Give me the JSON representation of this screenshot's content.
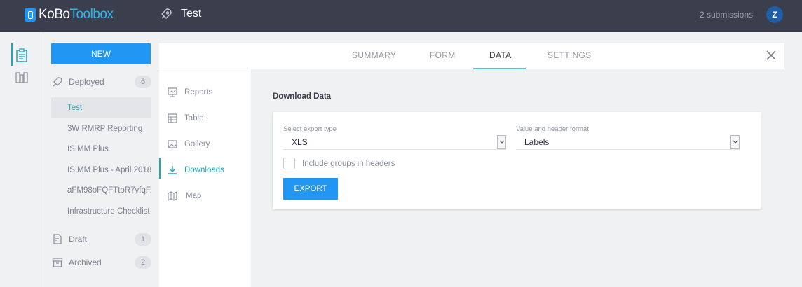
{
  "header": {
    "logo_main": "KoBo",
    "logo_thin": "Toolbox",
    "form_title": "Test",
    "submissions": "2 submissions",
    "avatar_initial": "Z"
  },
  "sidebar": {
    "new_label": "NEW",
    "groups": {
      "deployed": {
        "label": "Deployed",
        "count": "6"
      },
      "draft": {
        "label": "Draft",
        "count": "1"
      },
      "archived": {
        "label": "Archived",
        "count": "2"
      }
    },
    "projects": [
      {
        "label": "Test",
        "active": true
      },
      {
        "label": "3W RMRP Reporting"
      },
      {
        "label": "ISIMM Plus"
      },
      {
        "label": "ISIMM Plus - April 2018"
      },
      {
        "label": "aFM98oFQFTtoR7vfqF..."
      },
      {
        "label": "Infrastructure Checklist"
      }
    ]
  },
  "tabs": [
    {
      "label": "SUMMARY"
    },
    {
      "label": "FORM"
    },
    {
      "label": "DATA",
      "active": true
    },
    {
      "label": "SETTINGS"
    }
  ],
  "subnav": [
    {
      "label": "Reports",
      "icon": "reports-icon"
    },
    {
      "label": "Table",
      "icon": "table-icon"
    },
    {
      "label": "Gallery",
      "icon": "gallery-icon"
    },
    {
      "label": "Downloads",
      "icon": "download-icon",
      "active": true
    },
    {
      "label": "Map",
      "icon": "map-icon"
    }
  ],
  "download": {
    "title": "Download Data",
    "export_type_label": "Select export type",
    "export_type_value": "XLS",
    "format_label": "Value and header format",
    "format_value": "Labels",
    "groups_label": "Include groups in headers",
    "export_button": "EXPORT"
  },
  "colors": {
    "topbar": "#3a3e4d",
    "primary": "#2196f3",
    "teal": "#1ea6b8"
  }
}
